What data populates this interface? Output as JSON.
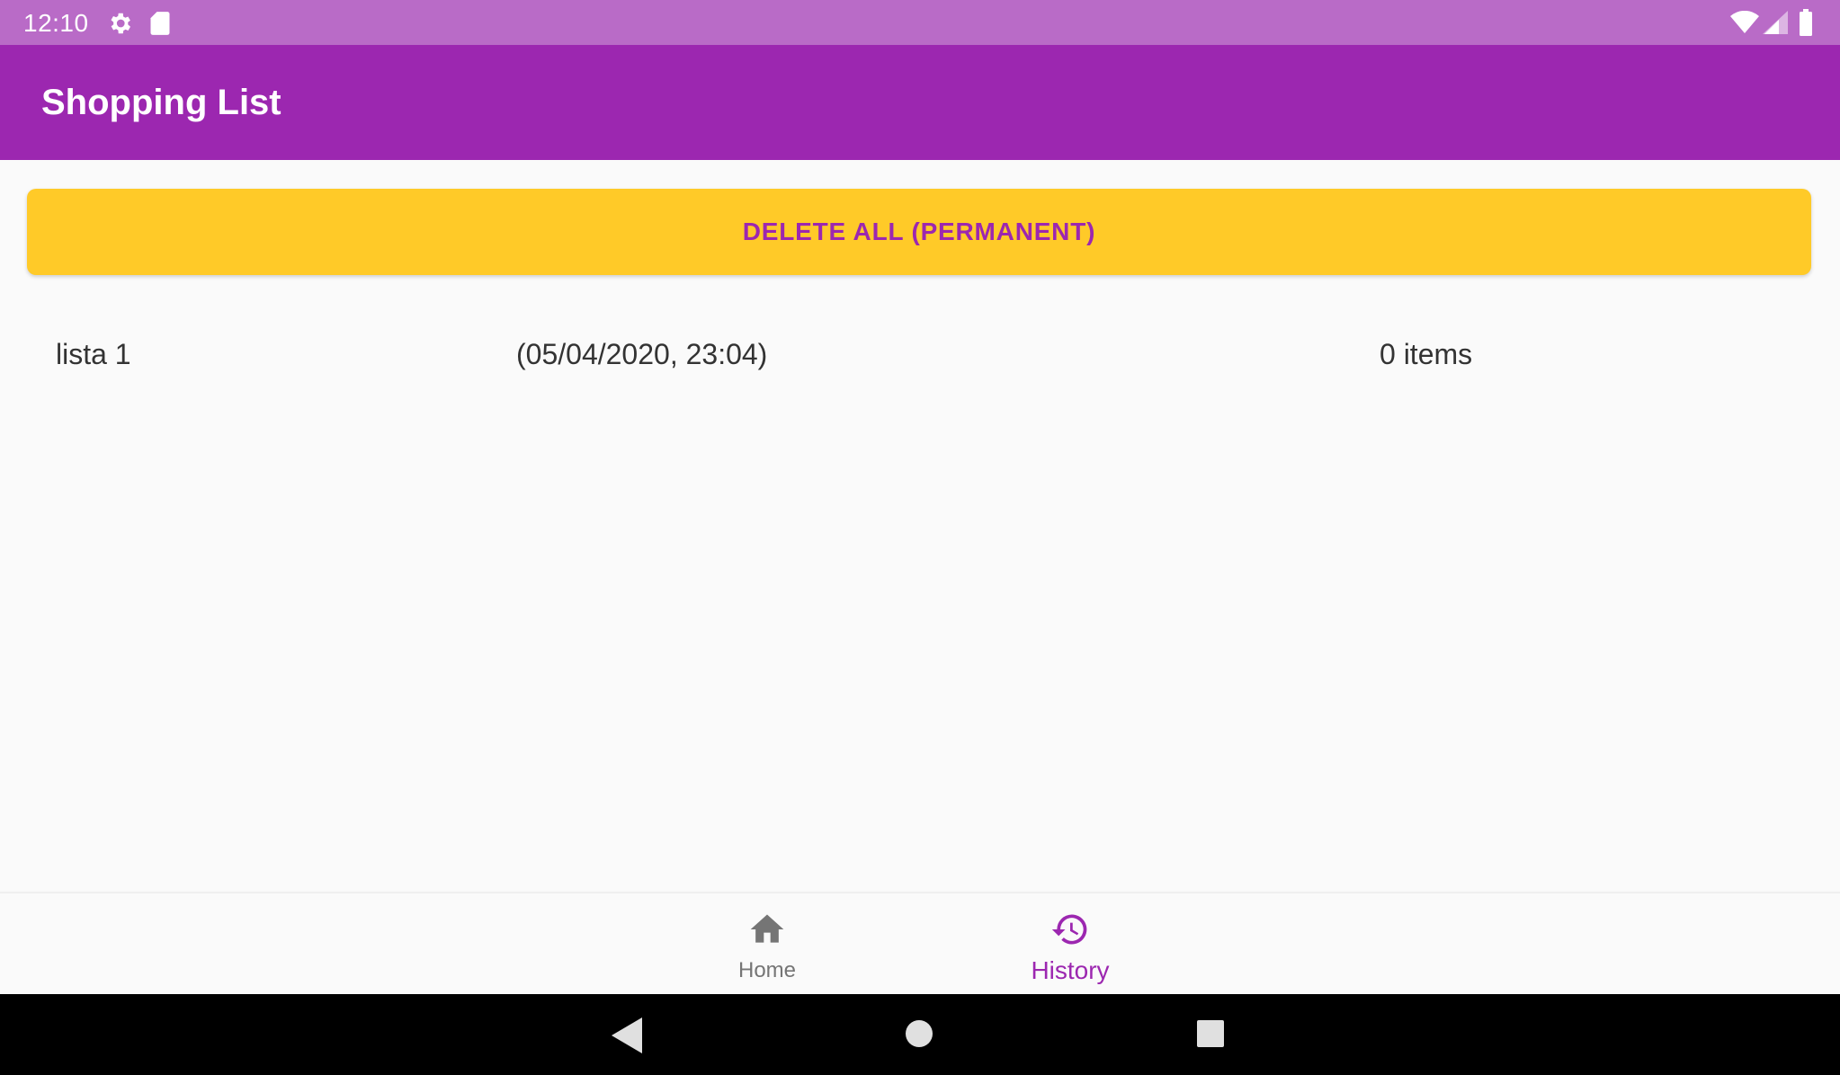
{
  "status_bar": {
    "time": "12:10",
    "icons": [
      "gear-icon",
      "sd-card-icon",
      "wifi-icon",
      "signal-icon",
      "battery-icon"
    ]
  },
  "app_bar": {
    "title": "Shopping List"
  },
  "actions": {
    "delete_all_label": "DELETE ALL (PERMANENT)"
  },
  "lists": [
    {
      "name": "lista 1",
      "date": "(05/04/2020, 23:04)",
      "count": "0 items"
    }
  ],
  "bottom_nav": {
    "items": [
      {
        "label": "Home",
        "icon": "home-icon",
        "selected": false
      },
      {
        "label": "History",
        "icon": "history-icon",
        "selected": true
      }
    ]
  },
  "system_nav": {
    "icons": [
      "back-icon",
      "home-circle-icon",
      "recents-icon"
    ]
  },
  "colors": {
    "primary": "#9c27b0",
    "status_bar": "#b96bc7",
    "accent": "#ffca28",
    "background": "#fafafa",
    "nav_inactive": "#757575"
  }
}
